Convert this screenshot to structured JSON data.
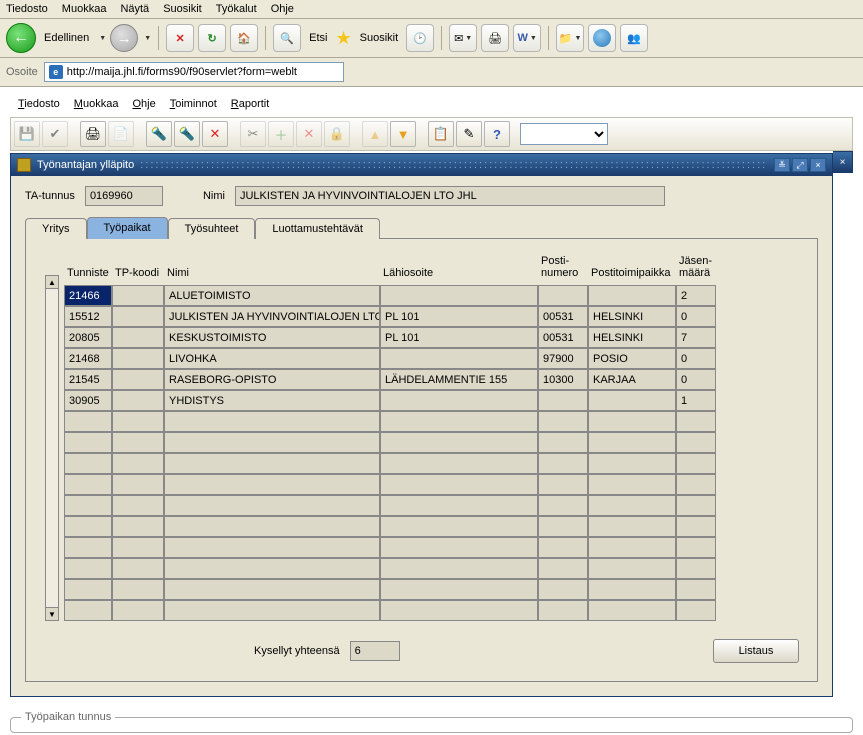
{
  "browser": {
    "menu": [
      "Tiedosto",
      "Muokkaa",
      "Näytä",
      "Suosikit",
      "Työkalut",
      "Ohje"
    ],
    "back_label": "Edellinen",
    "search_label": "Etsi",
    "fav_label": "Suosikit",
    "address_label": "Osoite",
    "url": "http://maija.jhl.fi/forms90/f90servlet?form=weblt"
  },
  "app": {
    "menu": {
      "tiedosto": "Tiedosto",
      "muokkaa": "Muokkaa",
      "ohje": "Ohje",
      "toiminnot": "Toiminnot",
      "raportit": "Raportit"
    }
  },
  "window": {
    "title": "Työnantajan ylläpito"
  },
  "header": {
    "ta_tunnus_label": "TA-tunnus",
    "ta_tunnus_value": "0169960",
    "nimi_label": "Nimi",
    "nimi_value": "JULKISTEN JA HYVINVOINTIALOJEN LTO JHL"
  },
  "tabs": {
    "yritys": "Yritys",
    "tyopaikat": "Työpaikat",
    "tyosuhteet": "Työsuhteet",
    "luottamus": "Luottamustehtävät"
  },
  "grid": {
    "headers": {
      "tunniste": "Tunniste",
      "tpkoodi": "TP-koodi",
      "nimi": "Nimi",
      "lahiosoite": "Lähiosoite",
      "postinumero_l1": "Posti-",
      "postinumero_l2": "numero",
      "postitoimipaikka": "Postitoimipaikka",
      "jasen_l1": "Jäsen-",
      "jasen_l2": "määrä"
    },
    "rows": [
      {
        "tunniste": "21466",
        "tpkoodi": "",
        "nimi": "ALUETOIMISTO",
        "lahiosoite": "",
        "postinumero": "",
        "postitoimipaikka": "",
        "jasenmaara": "2"
      },
      {
        "tunniste": "15512",
        "tpkoodi": "",
        "nimi": "JULKISTEN JA HYVINVOINTIALOJEN LTO JH",
        "lahiosoite": "PL 101",
        "postinumero": "00531",
        "postitoimipaikka": "HELSINKI",
        "jasenmaara": "0"
      },
      {
        "tunniste": "20805",
        "tpkoodi": "",
        "nimi": "KESKUSTOIMISTO",
        "lahiosoite": "PL 101",
        "postinumero": "00531",
        "postitoimipaikka": "HELSINKI",
        "jasenmaara": "7"
      },
      {
        "tunniste": "21468",
        "tpkoodi": "",
        "nimi": "LIVOHKA",
        "lahiosoite": "",
        "postinumero": "97900",
        "postitoimipaikka": "POSIO",
        "jasenmaara": "0"
      },
      {
        "tunniste": "21545",
        "tpkoodi": "",
        "nimi": "RASEBORG-OPISTO",
        "lahiosoite": "LÄHDELAMMENTIE 155",
        "postinumero": "10300",
        "postitoimipaikka": "KARJAA",
        "jasenmaara": "0"
      },
      {
        "tunniste": "30905",
        "tpkoodi": "",
        "nimi": "YHDISTYS",
        "lahiosoite": "",
        "postinumero": "",
        "postitoimipaikka": "",
        "jasenmaara": "1"
      }
    ],
    "empty_rows": 10
  },
  "footer": {
    "total_label": "Kysellyt yhteensä",
    "total_value": "6",
    "listaus_label": "Listaus"
  },
  "bottom_label": "Työpaikan tunnus"
}
